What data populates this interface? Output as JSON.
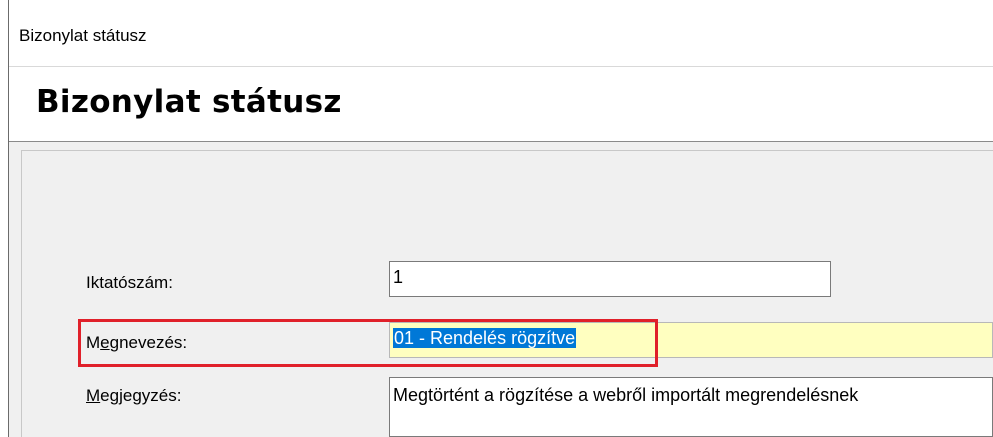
{
  "window": {
    "title": "Bizonylat státusz"
  },
  "header": {
    "title": "Bizonylat státusz"
  },
  "form": {
    "iktatoszam": {
      "label": "Iktatószám:",
      "value": "1"
    },
    "megnevezes": {
      "label_prefix": "M",
      "label_underlined": "e",
      "label_suffix": "gnevezés:",
      "value": "01 - Rendelés rögzítve"
    },
    "megjegyzes": {
      "label_underlined": "M",
      "label_suffix": "egjegyzés:",
      "value": "Megtörtént a rögzítése a webről importált megrendelésnek"
    }
  },
  "colors": {
    "accent_highlight": "#e0202a",
    "selection": "#0078d7",
    "required_field": "#ffffc0"
  }
}
